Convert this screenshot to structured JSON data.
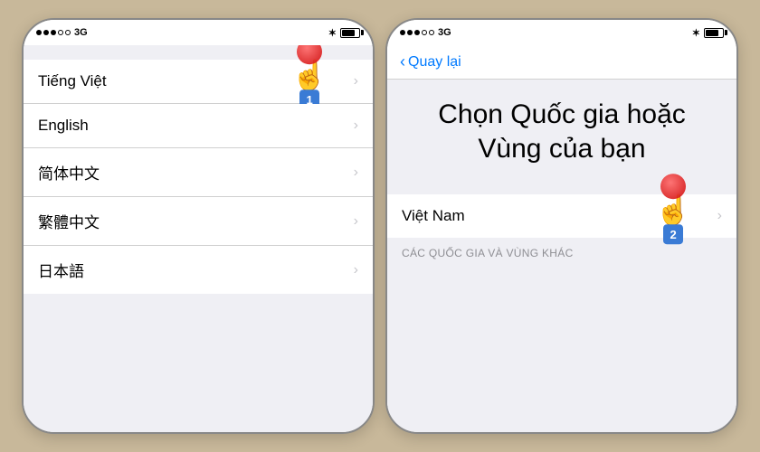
{
  "left_phone": {
    "status": {
      "signal_dots": 3,
      "network": "3G",
      "bluetooth": "⚙",
      "battery_level": "80"
    },
    "items": [
      {
        "label": "Tiếng Việt",
        "id": "tieng-viet"
      },
      {
        "label": "English",
        "id": "english"
      },
      {
        "label": "简体中文",
        "id": "simplified-chinese"
      },
      {
        "label": "繁體中文",
        "id": "traditional-chinese"
      },
      {
        "label": "日本語",
        "id": "japanese"
      }
    ],
    "cursor_on_item": 0,
    "cursor_number": "1"
  },
  "right_phone": {
    "status": {
      "signal_dots": 3,
      "network": "3G",
      "bluetooth": "⚙",
      "battery_level": "80"
    },
    "nav": {
      "back_label": "Quay lại"
    },
    "title": "Chọn Quốc gia hoặc\nVùng của bạn",
    "highlighted_item": {
      "label": "Việt Nam",
      "id": "viet-nam"
    },
    "section_footer": "CÁC QUỐC GIA VÀ VÙNG KHÁC",
    "cursor_number": "2"
  }
}
